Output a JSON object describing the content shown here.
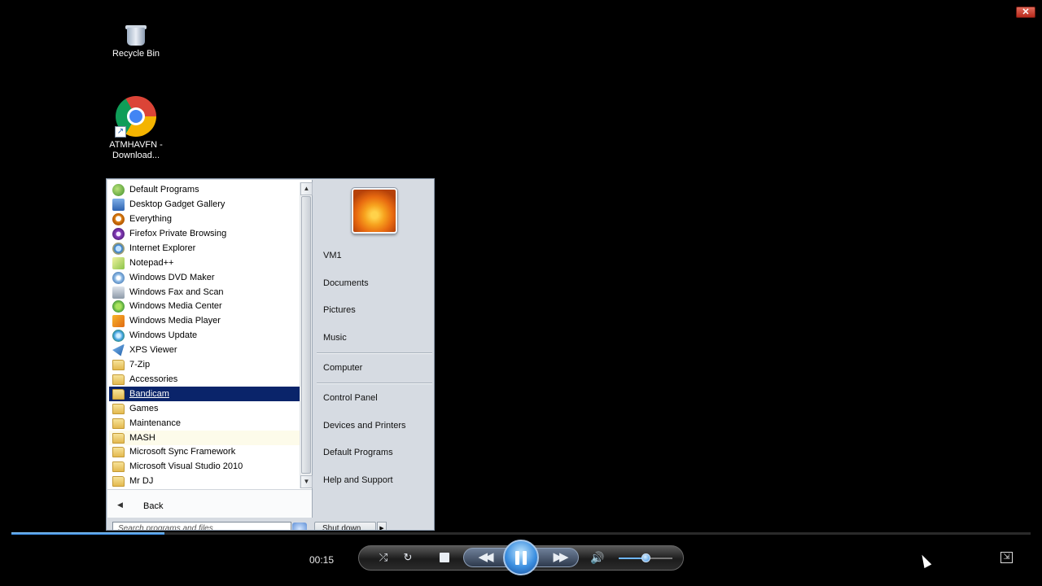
{
  "window": {
    "close_symbol": "✕"
  },
  "desktop": {
    "icons": [
      {
        "label": "Recycle Bin",
        "icon": "recycle-bin-icon"
      },
      {
        "label": "ATMHAVFN - Download...",
        "icon": "chrome-icon"
      }
    ]
  },
  "start_menu": {
    "programs": [
      {
        "label": "Default Programs",
        "icon": "default-programs-icon"
      },
      {
        "label": "Desktop Gadget Gallery",
        "icon": "gadget-gallery-icon"
      },
      {
        "label": "Everything",
        "icon": "everything-search-icon"
      },
      {
        "label": "Firefox Private Browsing",
        "icon": "firefox-private-icon"
      },
      {
        "label": "Internet Explorer",
        "icon": "internet-explorer-icon"
      },
      {
        "label": "Notepad++",
        "icon": "notepadpp-icon"
      },
      {
        "label": "Windows DVD Maker",
        "icon": "dvd-maker-icon"
      },
      {
        "label": "Windows Fax and Scan",
        "icon": "fax-scan-icon"
      },
      {
        "label": "Windows Media Center",
        "icon": "media-center-icon"
      },
      {
        "label": "Windows Media Player",
        "icon": "media-player-icon"
      },
      {
        "label": "Windows Update",
        "icon": "windows-update-icon"
      },
      {
        "label": "XPS Viewer",
        "icon": "xps-viewer-icon"
      },
      {
        "label": "7-Zip",
        "icon": "folder-icon"
      },
      {
        "label": "Accessories",
        "icon": "folder-icon"
      },
      {
        "label": "Bandicam",
        "icon": "folder-icon",
        "selected": true
      },
      {
        "label": "Games",
        "icon": "folder-icon"
      },
      {
        "label": "Maintenance",
        "icon": "folder-icon"
      },
      {
        "label": "MASH",
        "icon": "folder-icon"
      },
      {
        "label": "Microsoft Sync Framework",
        "icon": "folder-icon"
      },
      {
        "label": "Microsoft Visual Studio 2010",
        "icon": "folder-icon"
      },
      {
        "label": "Mr DJ",
        "icon": "folder-icon"
      }
    ],
    "back_label": "Back",
    "search_placeholder": "Search programs and files",
    "shutdown_label": "Shut down",
    "right_items": [
      {
        "label": "VM1"
      },
      {
        "label": "Documents"
      },
      {
        "label": "Pictures"
      },
      {
        "label": "Music"
      },
      {
        "label": "Computer"
      },
      {
        "label": "Control Panel"
      },
      {
        "label": "Devices and Printers"
      },
      {
        "label": "Default Programs"
      },
      {
        "label": "Help and Support"
      }
    ]
  },
  "player": {
    "time": "00:15",
    "progress_fraction": 0.15,
    "volume_fraction": 0.5,
    "state": "playing",
    "accent_color": "#3c8fe0"
  }
}
